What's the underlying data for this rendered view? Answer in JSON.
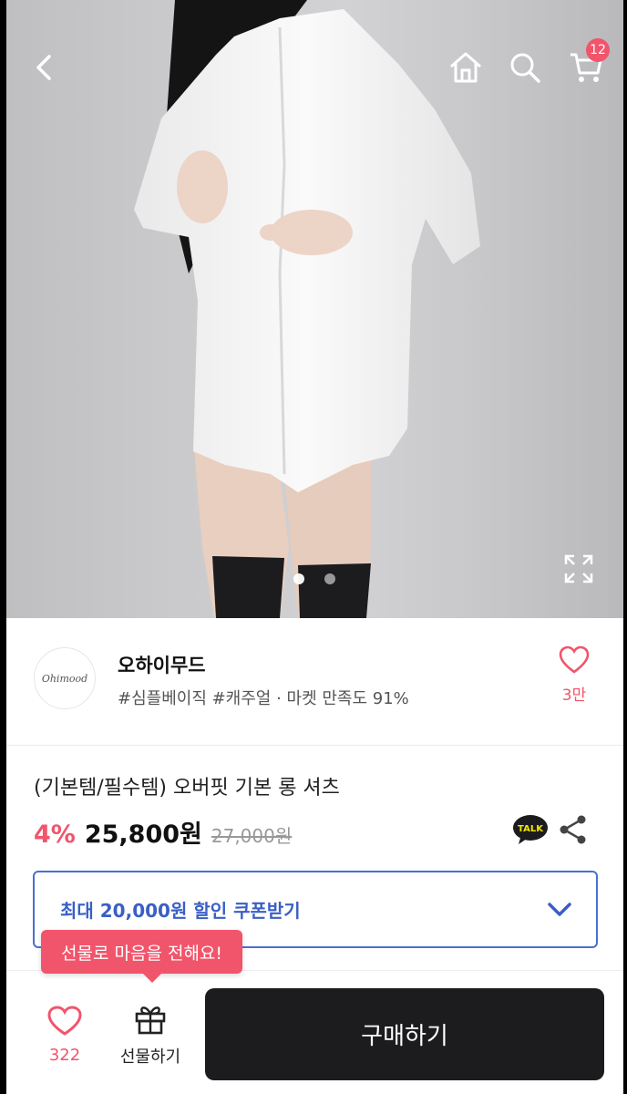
{
  "header": {
    "back_icon": "chevron-left-icon",
    "home_icon": "home-icon",
    "search_icon": "search-icon",
    "cart_icon": "cart-icon",
    "cart_count": "12"
  },
  "gallery": {
    "page_count": 2,
    "current_index": 1,
    "expand_icon": "expand-icon"
  },
  "store": {
    "logo_text": "Ohimood",
    "name": "오하이무드",
    "tags": "#심플베이직 #캐주얼 · 마켓 만족도 91%",
    "wish_count": "3만"
  },
  "product": {
    "title": "(기본템/필수템) 오버핏 기본 롱 셔츠",
    "discount": "4%",
    "price": "25,800원",
    "original_price": "27,000원",
    "talk_label": "TALK"
  },
  "coupon": {
    "text": "최대 20,000원 할인 쿠폰받기"
  },
  "tooltip": {
    "text": "선물로 마음을 전해요!"
  },
  "bottom_bar": {
    "like_count": "322",
    "gift_label": "선물하기",
    "buy_label": "구매하기"
  },
  "colors": {
    "accent": "#f1556b",
    "coupon_blue": "#3a5fc4",
    "buy_button": "#1c1c1e"
  }
}
